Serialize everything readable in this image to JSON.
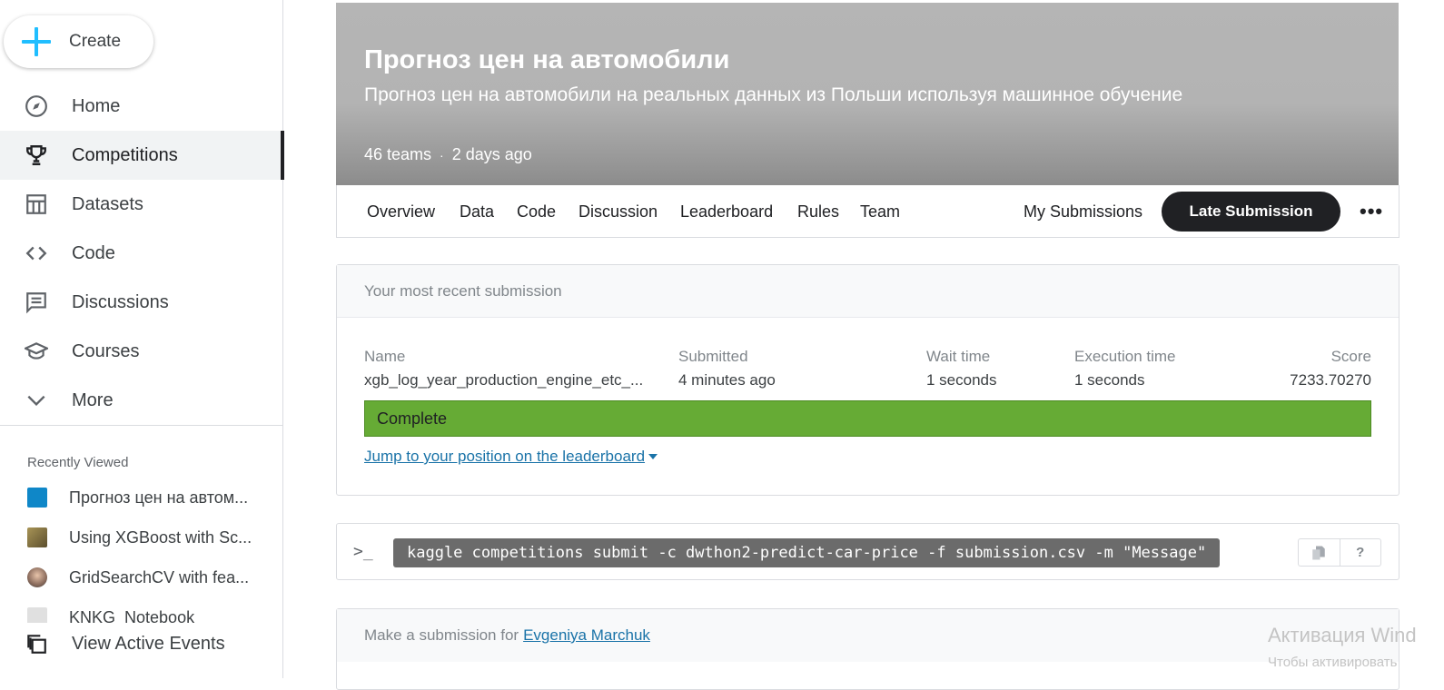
{
  "sidebar": {
    "create_label": "Create",
    "nav": [
      {
        "label": "Home",
        "icon": "compass-icon"
      },
      {
        "label": "Competitions",
        "icon": "trophy-icon",
        "active": true
      },
      {
        "label": "Datasets",
        "icon": "table-icon"
      },
      {
        "label": "Code",
        "icon": "code-icon"
      },
      {
        "label": "Discussions",
        "icon": "chat-icon"
      },
      {
        "label": "Courses",
        "icon": "graduation-cap-icon"
      },
      {
        "label": "More",
        "icon": "chevron-down-icon"
      }
    ],
    "recent_title": "Recently Viewed",
    "recent": [
      {
        "label": "Прогноз цен на автом...",
        "thumb_color": "#0f87c8"
      },
      {
        "label": "Using XGBoost with Sc...",
        "thumb_color": "#7a6a3a"
      },
      {
        "label": "GridSearchCV with fea...",
        "thumb_color": "#8a6b5c"
      },
      {
        "label": "KNKG_Notebook",
        "thumb_color": "#d0d0d0"
      }
    ],
    "active_events_label": "View Active Events"
  },
  "hero": {
    "title": "Прогноз цен на автомобили",
    "subtitle": "Прогноз цен на автомобили на реальных данных из Польши используя машинное обучение",
    "teams": "46 teams",
    "separator": "·",
    "updated": "2 days ago"
  },
  "tabs": {
    "items": [
      "Overview",
      "Data",
      "Code",
      "Discussion",
      "Leaderboard",
      "Rules",
      "Team"
    ],
    "my_submissions": "My Submissions",
    "late_submission": "Late Submission",
    "more": "•••"
  },
  "submission": {
    "header": "Your most recent submission",
    "name_label": "Name",
    "name_value": "xgb_log_year_production_engine_etc_...",
    "submitted_label": "Submitted",
    "submitted_value": "4 minutes ago",
    "wait_label": "Wait time",
    "wait_value": "1 seconds",
    "exec_label": "Execution time",
    "exec_value": "1 seconds",
    "score_label": "Score",
    "score_value": "7233.70270",
    "status": "Complete",
    "status_color": "#66ab35",
    "jump_link": "Jump to your position on the leaderboard"
  },
  "command": {
    "prompt": ">_",
    "text": "kaggle competitions submit -c dwthon2-predict-car-price -f submission.csv -m \"Message\"",
    "copy_icon": "copy-icon",
    "help_label": "?"
  },
  "make_submission": {
    "prefix": "Make a submission for",
    "user": "Evgeniya Marchuk"
  },
  "watermark": {
    "line1": "Активация Wind",
    "line2": "Чтобы активировать"
  }
}
